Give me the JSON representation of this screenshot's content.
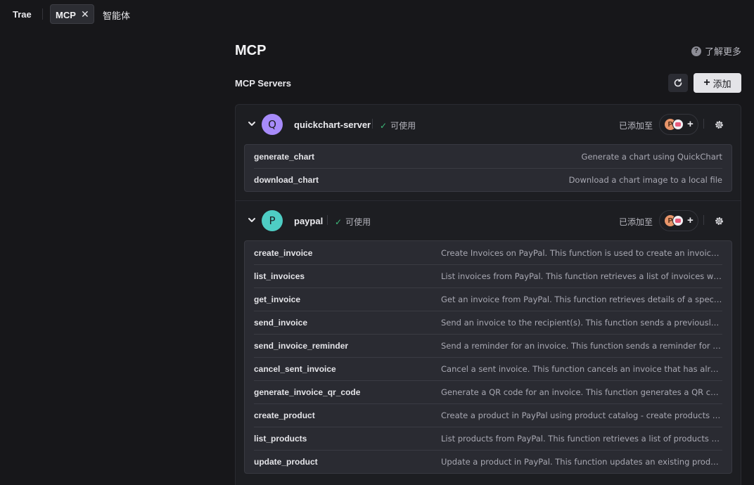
{
  "tabs": {
    "trae": "Trae",
    "mcp": "MCP",
    "mcp_close": "✕",
    "agent": "智能体"
  },
  "header": {
    "title": "MCP",
    "help_glyph": "?",
    "learn_more": "了解更多",
    "section_title": "MCP Servers",
    "add_plus": "+",
    "add_label": "添加"
  },
  "servers": [
    {
      "initial": "Q",
      "name": "quickchart-server",
      "avatar_color": "#a78bfa",
      "status_check": "✓",
      "status": "可使用",
      "added_label": "已添加至",
      "agent_initial": "P",
      "agent_plus": "+",
      "tools": [
        {
          "name": "generate_chart",
          "desc": "Generate a chart using QuickChart"
        },
        {
          "name": "download_chart",
          "desc": "Download a chart image to a local file"
        }
      ]
    },
    {
      "initial": "P",
      "name": "paypal",
      "avatar_color": "#4ecdc4",
      "status_check": "✓",
      "status": "可使用",
      "added_label": "已添加至",
      "agent_initial": "P",
      "agent_plus": "+",
      "tools": [
        {
          "name": "create_invoice",
          "desc": "Create Invoices on PayPal. This function is used to create an invoice in th..."
        },
        {
          "name": "list_invoices",
          "desc": "List invoices from PayPal. This function retrieves a list of invoices with opt..."
        },
        {
          "name": "get_invoice",
          "desc": "Get an invoice from PayPal. This function retrieves details of a specific inv..."
        },
        {
          "name": "send_invoice",
          "desc": "Send an invoice to the recipient(s). This function sends a previously creat..."
        },
        {
          "name": "send_invoice_reminder",
          "desc": "Send a reminder for an invoice. This function sends a reminder for an inv..."
        },
        {
          "name": "cancel_sent_invoice",
          "desc": "Cancel a sent invoice. This function cancels an invoice that has already be..."
        },
        {
          "name": "generate_invoice_qr_code",
          "desc": "Generate a QR code for an invoice. This function generates a QR code for"
        },
        {
          "name": "create_product",
          "desc": "Create a product in PayPal using product catalog - create products API. T..."
        },
        {
          "name": "list_products",
          "desc": "List products from PayPal. This function retrieves a list of products with o..."
        },
        {
          "name": "update_product",
          "desc": "Update a product in PayPal. This function updates an existing product usi..."
        }
      ]
    }
  ],
  "colors": {
    "accent_check": "#3dbb7a",
    "background": "#17171a",
    "panel": "#2a2b32"
  }
}
